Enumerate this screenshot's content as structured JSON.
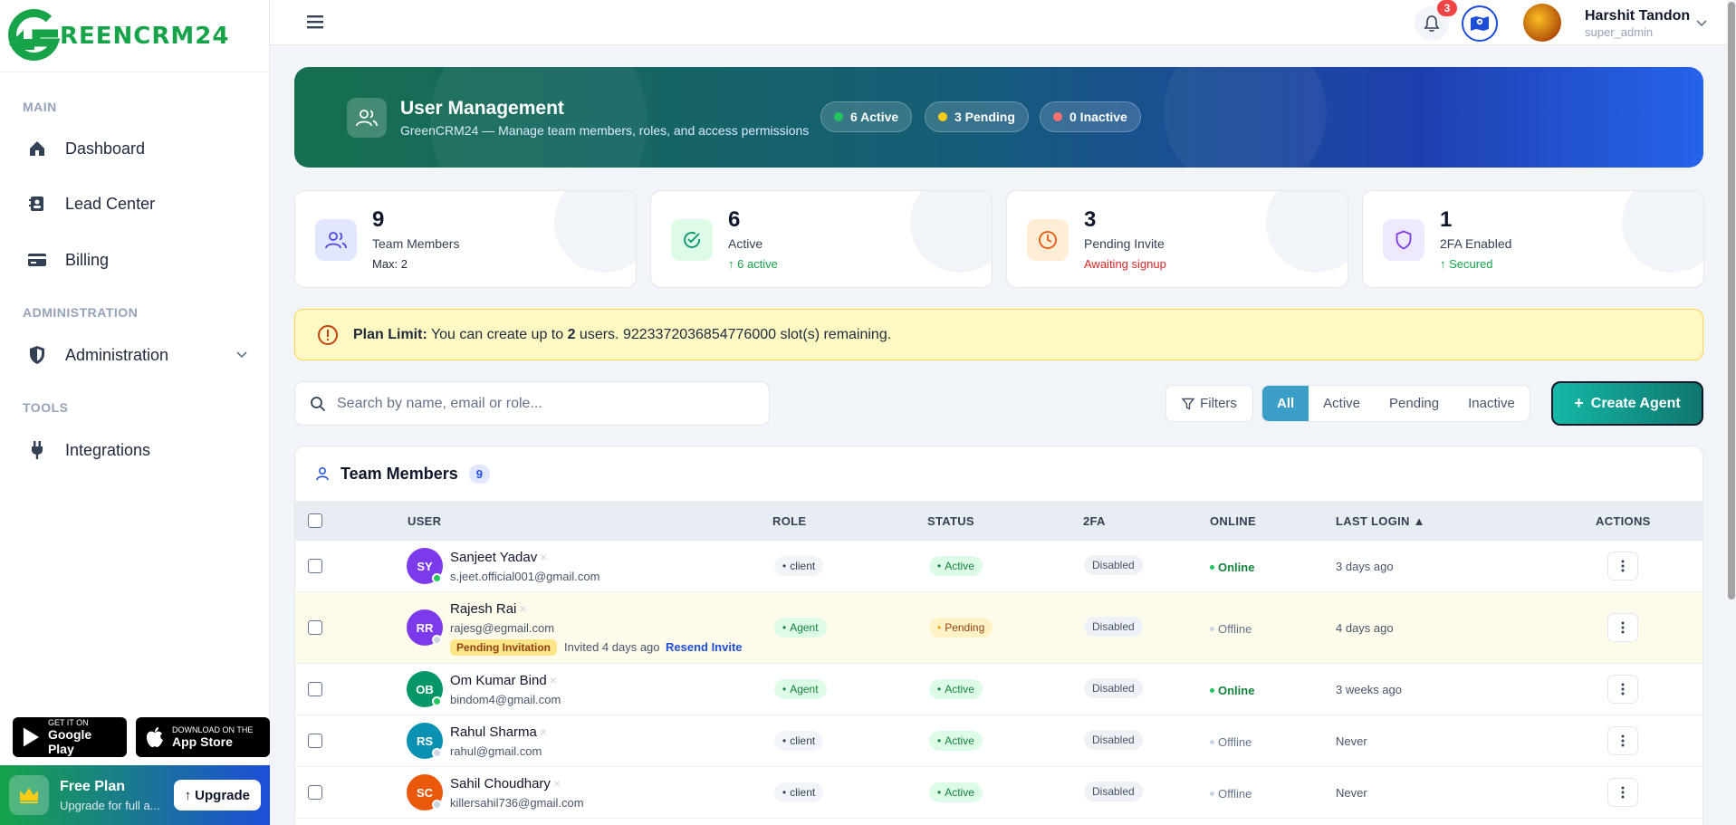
{
  "brand": {
    "name": "REENCRM24",
    "primary": "#16a34a",
    "accent": "#1d4ed8"
  },
  "sidebar": {
    "sections": [
      {
        "label": "MAIN",
        "items": [
          {
            "label": "Dashboard",
            "icon": "home-icon"
          },
          {
            "label": "Lead Center",
            "icon": "contact-book-icon"
          },
          {
            "label": "Billing",
            "icon": "credit-card-icon"
          }
        ]
      },
      {
        "label": "ADMINISTRATION",
        "items": [
          {
            "label": "Administration",
            "icon": "shield-icon"
          }
        ]
      },
      {
        "label": "TOOLS",
        "items": [
          {
            "label": "Integrations",
            "icon": "plug-icon"
          }
        ]
      }
    ],
    "google_play": {
      "small": "GET IT ON",
      "big": "Google Play"
    },
    "app_store": {
      "small": "DOWNLOAD ON THE",
      "big": "App Store"
    },
    "plan": {
      "title": "Free Plan",
      "subtitle": "Upgrade for full a...",
      "button": "Upgrade"
    }
  },
  "topbar": {
    "notification_count": "3",
    "user": {
      "name": "Harshit Tandon",
      "role": "super_admin"
    }
  },
  "banner": {
    "title": "User Management",
    "subtitle": "GreenCRM24 — Manage team members, roles, and access permissions",
    "pills": [
      {
        "label": "6 Active",
        "color": "#22c55e"
      },
      {
        "label": "3 Pending",
        "color": "#facc15"
      },
      {
        "label": "0 Inactive",
        "color": "#f87171"
      }
    ]
  },
  "stats": [
    {
      "value": "9",
      "label": "Team Members",
      "sub": "Max: 2",
      "sub_color": "#1e293b",
      "icon": "users-icon"
    },
    {
      "value": "6",
      "label": "Active",
      "sub": "↑ 6 active",
      "sub_color": "#16a34a",
      "icon": "check-circle-icon"
    },
    {
      "value": "3",
      "label": "Pending Invite",
      "sub": "Awaiting signup",
      "sub_color": "#dc2626",
      "icon": "clock-icon"
    },
    {
      "value": "1",
      "label": "2FA Enabled",
      "sub": "↑ Secured",
      "sub_color": "#16a34a",
      "icon": "shield-icon"
    }
  ],
  "plan_limit": {
    "label": "Plan Limit:",
    "text_before": " You can create up to ",
    "count": "2",
    "text_after": " users. 9223372036854776000 slot(s) remaining."
  },
  "search": {
    "placeholder": "Search by name, email or role..."
  },
  "filters_label": "Filters",
  "segments": [
    "All",
    "Active",
    "Pending",
    "Inactive"
  ],
  "create_button": "Create Agent",
  "table": {
    "title": "Team Members",
    "count": "9",
    "columns": [
      "USER",
      "ROLE",
      "STATUS",
      "2FA",
      "ONLINE",
      "LAST LOGIN ▲",
      "ACTIONS"
    ],
    "rows": [
      {
        "initials": "SY",
        "name": "Sanjeet Yadav",
        "email": "s.jeet.official001@gmail.com",
        "role": "client",
        "status": "Active",
        "twofa": "Disabled",
        "online": "Online",
        "last_login": "3 days ago",
        "avatar_color": "#7c3aed"
      },
      {
        "initials": "RR",
        "name": "Rajesh Rai",
        "email": "rajesg@egmail.com",
        "role": "Agent",
        "status": "Pending",
        "twofa": "Disabled",
        "online": "Offline",
        "last_login": "4 days ago",
        "avatar_color": "#7c3aed",
        "pending_badge": "Pending Invitation",
        "invited": "Invited 4 days ago",
        "resend": "Resend Invite"
      },
      {
        "initials": "OB",
        "name": "Om Kumar Bind",
        "email": "bindom4@gmail.com",
        "role": "Agent",
        "status": "Active",
        "twofa": "Disabled",
        "online": "Online",
        "last_login": "3 weeks ago",
        "avatar_color": "#059669"
      },
      {
        "initials": "RS",
        "name": "Rahul Sharma",
        "email": "rahul@gmail.com",
        "role": "client",
        "status": "Active",
        "twofa": "Disabled",
        "online": "Offline",
        "last_login": "Never",
        "avatar_color": "#0891b2"
      },
      {
        "initials": "SC",
        "name": "Sahil Choudhary",
        "email": "killersahil736@gmail.com",
        "role": "client",
        "status": "Active",
        "twofa": "Disabled",
        "online": "Offline",
        "last_login": "Never",
        "avatar_color": "#ea580c"
      }
    ]
  }
}
